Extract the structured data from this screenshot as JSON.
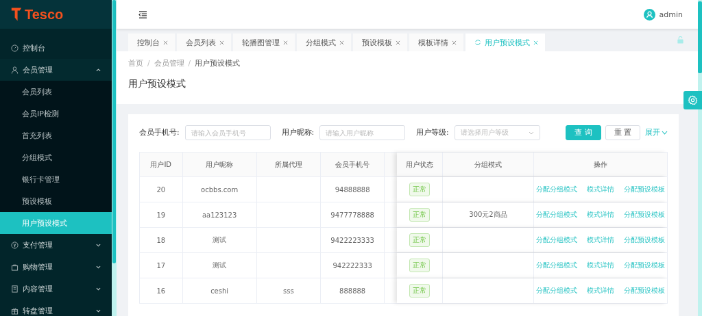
{
  "logo": {
    "text": "Tesco"
  },
  "sidebar": {
    "items": [
      {
        "label": "控制台",
        "selected": false
      },
      {
        "label": "会员管理",
        "selected": false,
        "expanded": true,
        "children": [
          {
            "label": "会员列表",
            "selected": false
          },
          {
            "label": "会员IP检测",
            "selected": false
          },
          {
            "label": "首充列表",
            "selected": false
          },
          {
            "label": "分组模式",
            "selected": false
          },
          {
            "label": "银行卡管理",
            "selected": false
          },
          {
            "label": "预设模板",
            "selected": false
          },
          {
            "label": "用户预设模式",
            "selected": true
          }
        ]
      },
      {
        "label": "支付管理",
        "selected": false,
        "expanded": false
      },
      {
        "label": "购物管理",
        "selected": false,
        "expanded": false
      },
      {
        "label": "内容管理",
        "selected": false,
        "expanded": false
      },
      {
        "label": "转盘管理",
        "selected": false,
        "expanded": false
      }
    ]
  },
  "header": {
    "user": "admin"
  },
  "tabs": [
    {
      "label": "控制台",
      "selected": false
    },
    {
      "label": "会员列表",
      "selected": false
    },
    {
      "label": "轮播图管理",
      "selected": false
    },
    {
      "label": "分组模式",
      "selected": false
    },
    {
      "label": "预设模板",
      "selected": false
    },
    {
      "label": "模板详情",
      "selected": false
    },
    {
      "label": "用户预设模式",
      "selected": true
    }
  ],
  "breadcrumb": {
    "separator": "/",
    "items": [
      "首页",
      "会员管理",
      "用户预设模式"
    ]
  },
  "page_title": "用户预设模式",
  "filters": [
    {
      "kind": "input",
      "label": "会员手机号:",
      "placeholder": "请输入会员手机号"
    },
    {
      "kind": "input",
      "label": "用户昵称:",
      "placeholder": "请输入用户昵称"
    },
    {
      "kind": "select",
      "label": "用户等级:",
      "placeholder": "请选择用户等级"
    }
  ],
  "buttons": {
    "search": "查 询",
    "reset": "重 置",
    "expand": "展开"
  },
  "table": {
    "columns": [
      "用户ID",
      "用户昵称",
      "所属代理",
      "会员手机号",
      "用户状态",
      "分组模式",
      "操作"
    ],
    "rows": [
      {
        "id": "20",
        "nickname": "ocbbs.com",
        "agent": "",
        "phone": "94888888",
        "status": "正常",
        "group_mode": "",
        "actions": [
          "分配分组模式",
          "模式详情",
          "分配预设模板"
        ]
      },
      {
        "id": "19",
        "nickname": "aa123123",
        "agent": "",
        "phone": "9477778888",
        "status": "正常",
        "group_mode": "300元2商品",
        "actions": [
          "分配分组模式",
          "模式详情",
          "分配预设模板"
        ]
      },
      {
        "id": "18",
        "nickname": "测试",
        "agent": "",
        "phone": "9422223333",
        "status": "正常",
        "group_mode": "",
        "actions": [
          "分配分组模式",
          "模式详情",
          "分配预设模板"
        ]
      },
      {
        "id": "17",
        "nickname": "测试",
        "agent": "",
        "phone": "942222333",
        "status": "正常",
        "group_mode": "",
        "actions": [
          "分配分组模式",
          "模式详情",
          "分配预设模板"
        ]
      },
      {
        "id": "16",
        "nickname": "ceshi",
        "agent": "sss",
        "phone": "888888",
        "status": "正常",
        "group_mode": "",
        "actions": [
          "分配分组模式",
          "模式详情",
          "分配预设模板"
        ]
      }
    ]
  }
}
